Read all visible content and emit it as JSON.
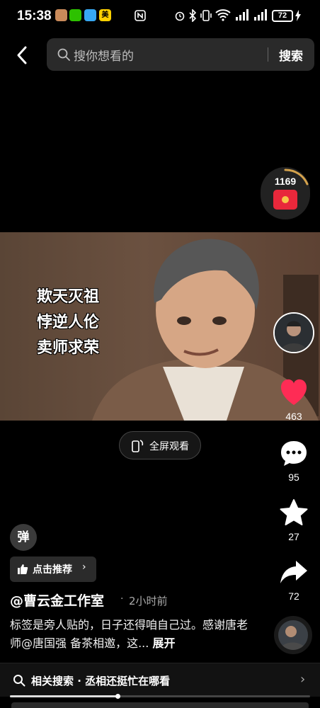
{
  "status_bar": {
    "time": "15:38",
    "app_badge_food": "美",
    "battery": "72"
  },
  "search": {
    "placeholder": "搜你想看的",
    "button": "搜索"
  },
  "reward": {
    "count": "1169"
  },
  "video": {
    "caption_lines": [
      "欺天灭祖",
      "悖逆人伦",
      "卖师求荣"
    ]
  },
  "fullscreen": {
    "label": "全屏观看"
  },
  "rail": {
    "likes": "463",
    "comments": "95",
    "favorites": "27",
    "shares": "72"
  },
  "danmu": {
    "label": "弹"
  },
  "recommend": {
    "label": "点击推荐",
    "chevron": "›"
  },
  "post": {
    "author": "@曹云金工作室",
    "separator": "·",
    "time_ago": "2小时前",
    "description": "标签是旁人贴的，日子还得咱自己过。感谢唐老师@唐国强 备茶相邀，这...",
    "expand": "展开"
  },
  "related": {
    "text": "相关搜索 · 丞相还挺忙在哪看",
    "chevron": "›"
  },
  "playback": {
    "progress": 0.36
  },
  "colors": {
    "like": "#fe2c55",
    "red_packet": "#e8283b",
    "background": "#000000"
  }
}
